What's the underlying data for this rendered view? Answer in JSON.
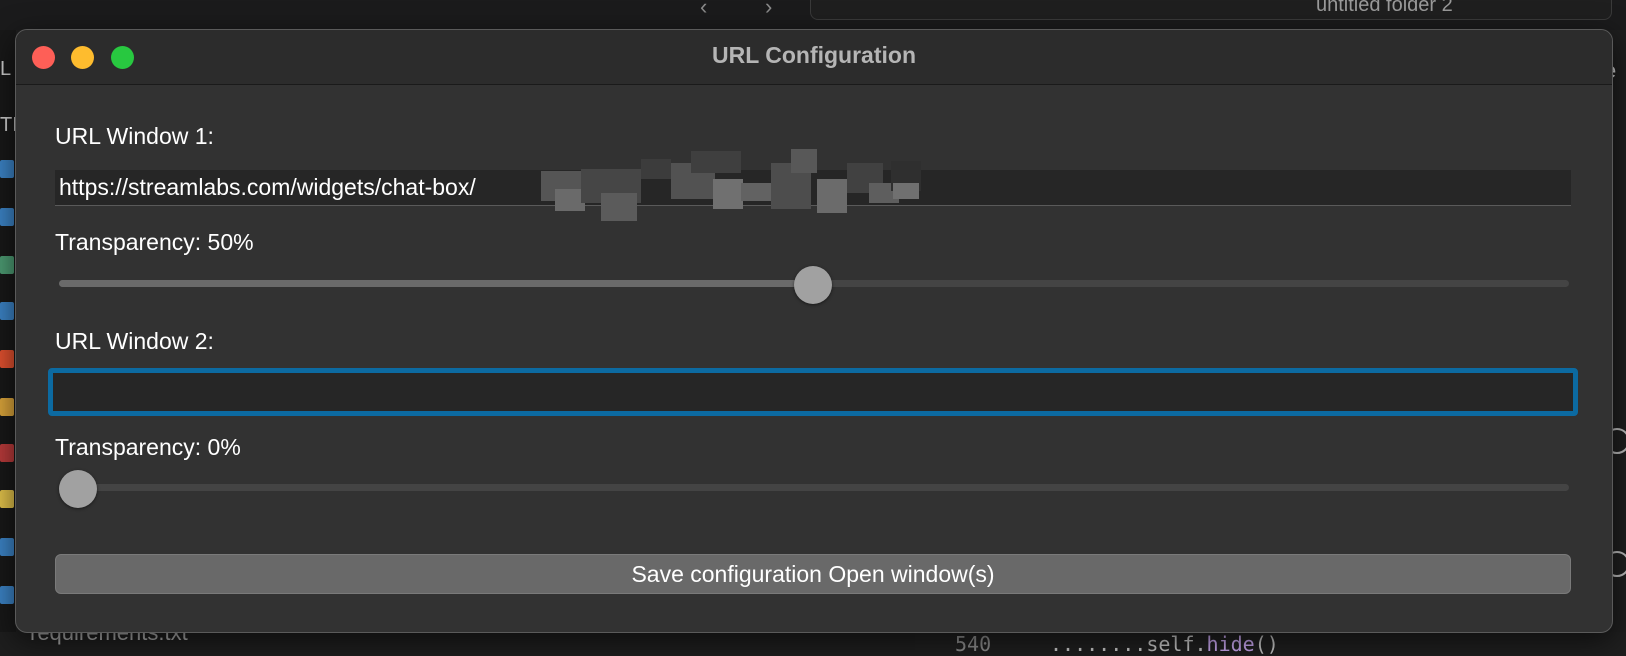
{
  "background": {
    "finder_path": "untitled folder 2",
    "sidebar_file": "requirements.txt",
    "editor_line_number": "540",
    "editor_code_prefix": "........self.",
    "editor_code_fn": "hide",
    "editor_code_suffix": "()",
    "right_edge_char": "e",
    "left_edge_chars": [
      "L",
      "TI"
    ]
  },
  "window": {
    "title": "URL Configuration",
    "controls": [
      "close",
      "minimize",
      "zoom"
    ]
  },
  "form": {
    "url1": {
      "label": "URL Window 1:",
      "value": "https://streamlabs.com/widgets/chat-box/",
      "redacted": true
    },
    "transparency1": {
      "label": "Transparency: 50%",
      "value": 50
    },
    "url2": {
      "label": "URL Window 2:",
      "value": "",
      "focused": true
    },
    "transparency2": {
      "label": "Transparency: 0%",
      "value": 0
    },
    "save_button_label": "Save configuration  Open window(s)"
  },
  "colors": {
    "focus_ring": "#0c6aa1",
    "close": "#fe5f57",
    "minimize": "#febc2e",
    "zoom": "#28c840"
  }
}
